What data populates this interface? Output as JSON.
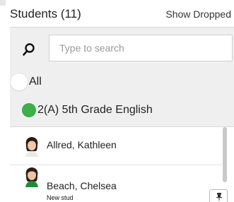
{
  "header": {
    "title": "Students (11)",
    "show_dropped_label": "Show Dropped"
  },
  "search": {
    "icon": "search-icon",
    "placeholder": "Type to search",
    "value": ""
  },
  "filters": [
    {
      "label": "All",
      "selected": false
    },
    {
      "label": "2(A) 5th Grade English",
      "selected": true,
      "color": "#3dae49"
    }
  ],
  "students": [
    {
      "name": "Allred, Kathleen",
      "sub": ""
    },
    {
      "name": "Beach, Chelsea",
      "sub": "New stud"
    }
  ],
  "colors": {
    "panel_background": "#efeff0",
    "selected_radio": "#3dae49"
  },
  "footer": {
    "corner_button_icon": "pin-icon"
  }
}
